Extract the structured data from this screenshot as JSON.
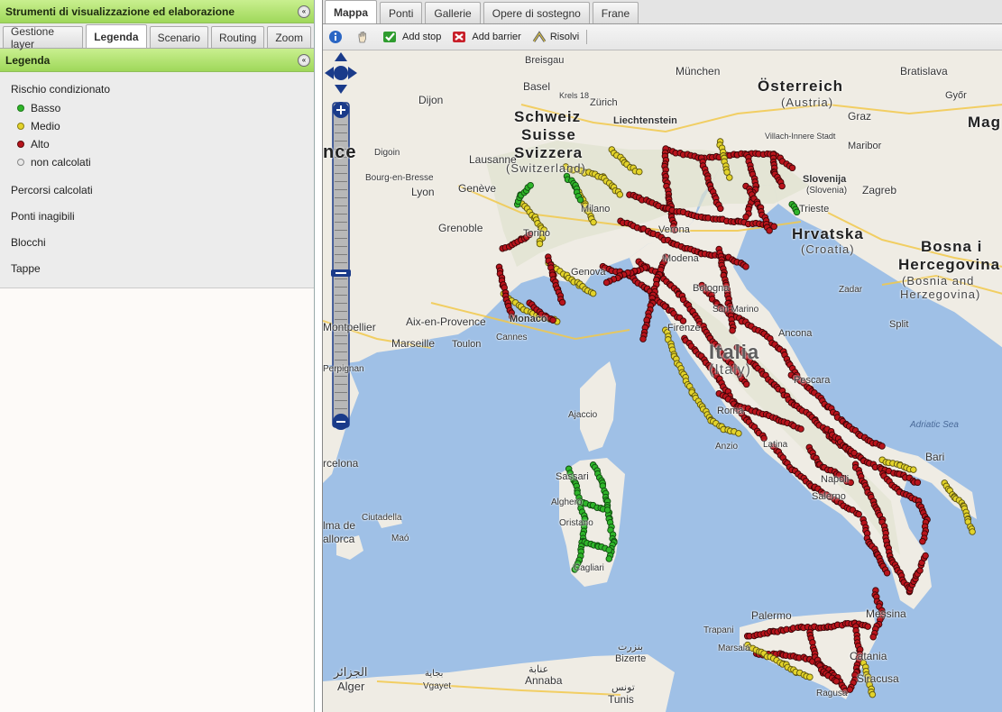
{
  "left_panel": {
    "title": "Strumenti di visualizzazione ed elaborazione",
    "tabs": [
      "Gestione layer",
      "Legenda",
      "Scenario",
      "Routing",
      "Zoom"
    ],
    "active_tab": "Legenda",
    "legend": {
      "header": "Legenda",
      "group_title": "Rischio condizionato",
      "items": [
        {
          "label": "Basso",
          "color": "#2fb52a"
        },
        {
          "label": "Medio",
          "color": "#e3d32a"
        },
        {
          "label": "Alto",
          "color": "#b8141c"
        },
        {
          "label": "non calcolati",
          "color": "#e8e8e8"
        }
      ],
      "sections": [
        "Percorsi calcolati",
        "Ponti inagibili",
        "Blocchi",
        "Tappe"
      ]
    }
  },
  "map_panel": {
    "tabs": [
      "Mappa",
      "Ponti",
      "Gallerie",
      "Opere di sostegno",
      "Frane"
    ],
    "active_tab": "Mappa",
    "toolbar": {
      "info_icon": "info-icon",
      "pan_icon": "hand-icon",
      "add_stop": "Add stop",
      "add_barrier": "Add barrier",
      "solve": "Risolvi"
    },
    "labels": {
      "schweiz": "Schweiz",
      "suisse": "Suisse",
      "svizzera": "Svizzera",
      "switzerland": "(Switzerland)",
      "osterreich": "Österreich",
      "austria": "(Austria)",
      "liechtenstein": "Liechtenstein",
      "slovenija": "Slovenija",
      "slovenia": "(Slovenia)",
      "hrvatska": "Hrvatska",
      "croatia": "(Croatia)",
      "bosna1": "Bosna i",
      "bosna2": "Hercegovina",
      "bosna3": "(Bosnia and",
      "bosna4": "Herzegovina)",
      "mag": "Mag",
      "france": "nce",
      "italia": "Italia",
      "italy": "(Italy)",
      "adriatic": "Adriatic Sea",
      "breisgau": "Breisgau",
      "munchen": "München",
      "bratislava": "Bratislava",
      "basel": "Basel",
      "krels": "Krels 18",
      "dijon": "Dijon",
      "zurich": "Zürich",
      "graz": "Graz",
      "gyor": "Győr",
      "villach": "Villach-Innere Stadt",
      "maribor": "Maribor",
      "lausanne": "Lausanne",
      "digoin": "Digoin",
      "bourg": "Bourg-en-Bresse",
      "geneve": "Genève",
      "lyon": "Lyon",
      "grenoble": "Grenoble",
      "trieste": "Trieste",
      "zagreb": "Zagreb",
      "verona": "Verona",
      "genova": "Genova",
      "torino": "Torino",
      "milano": "Milano",
      "modena": "Modena",
      "bologna": "Bologna",
      "sanmarino": "San Marino",
      "firenze": "Firenze",
      "ancona": "Ancona",
      "pescara": "Pescara",
      "roma": "Roma",
      "anzio": "Anzio",
      "latina": "Latina",
      "napoli": "Napoli",
      "salerno": "Salerno",
      "bari": "Bari",
      "zadar": "Zadar",
      "split": "Split",
      "montpellier": "Montpellier",
      "aix": "Aix-en-Provence",
      "monaco": "Monaco",
      "marseille": "Marseille",
      "toulon": "Toulon",
      "cannes": "Cannes",
      "perpignan": "Perpignan",
      "ajaccio": "Ajaccio",
      "sassari": "Sassari",
      "alghero": "Alghero",
      "oristano": "Oristano",
      "cagliari": "Cagliari",
      "barcelona": "rcelona",
      "palma": "lma de",
      "mallorca": "allorca",
      "ciutadella": "Ciutadella",
      "mao": "Maó",
      "palermo": "Palermo",
      "messina": "Messina",
      "catania": "Catania",
      "siracusa": "Siracusa",
      "ragusa": "Ragusa",
      "trapani": "Trapani",
      "marsala": "Marsala",
      "bizerte": "Bizerte",
      "bizerte_ar": "بنزرت",
      "annaba": "Annaba",
      "annaba_ar": "عنابة",
      "bejaia": "Vgayet",
      "bejaia_ar": "بجاية",
      "alger": "Alger",
      "alger_ar": "الجزائر",
      "tunis": "Tunis",
      "tunis_ar": "تونس"
    }
  }
}
